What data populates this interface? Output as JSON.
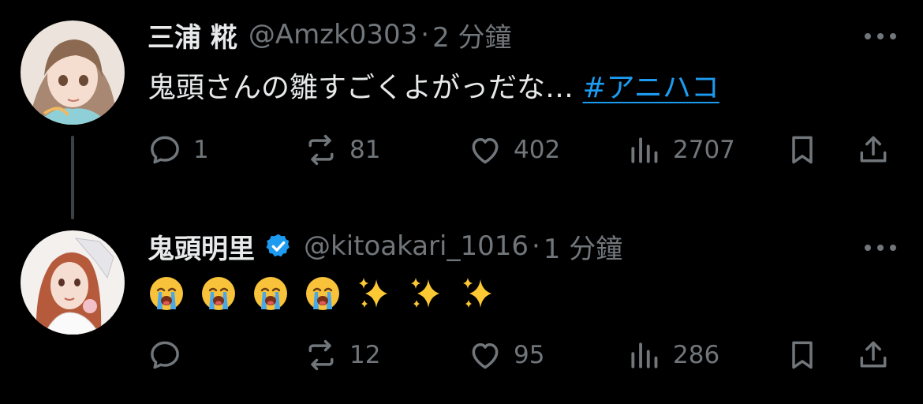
{
  "tweets": [
    {
      "display_name": "三浦 糀",
      "handle": "@Amzk0303",
      "separator": "·",
      "time": "2 分鐘",
      "verified": false,
      "text": "鬼頭さんの雛すごくよがっだな…",
      "hashtag": "#アニハコ",
      "replies": "1",
      "reposts": "81",
      "likes": "402",
      "views": "2707"
    },
    {
      "display_name": "鬼頭明里",
      "handle": "@kitoakari_1016",
      "separator": "·",
      "time": "1 分鐘",
      "verified": true,
      "emojis": [
        "😭",
        "😭",
        "😭",
        "😭",
        "✨",
        "✨",
        "✨"
      ],
      "replies": "",
      "reposts": "12",
      "likes": "95",
      "views": "286"
    }
  ],
  "icons": {
    "more": "more-horizontal-icon",
    "reply": "reply-icon",
    "repost": "repost-icon",
    "like": "like-icon",
    "views": "views-icon",
    "bookmark": "bookmark-icon",
    "share": "share-icon",
    "verified": "verified-badge-icon"
  },
  "colors": {
    "background": "#000000",
    "text": "#e7e9ea",
    "secondary": "#71767b",
    "link": "#1d9bf0",
    "thread_line": "#3e4144"
  }
}
